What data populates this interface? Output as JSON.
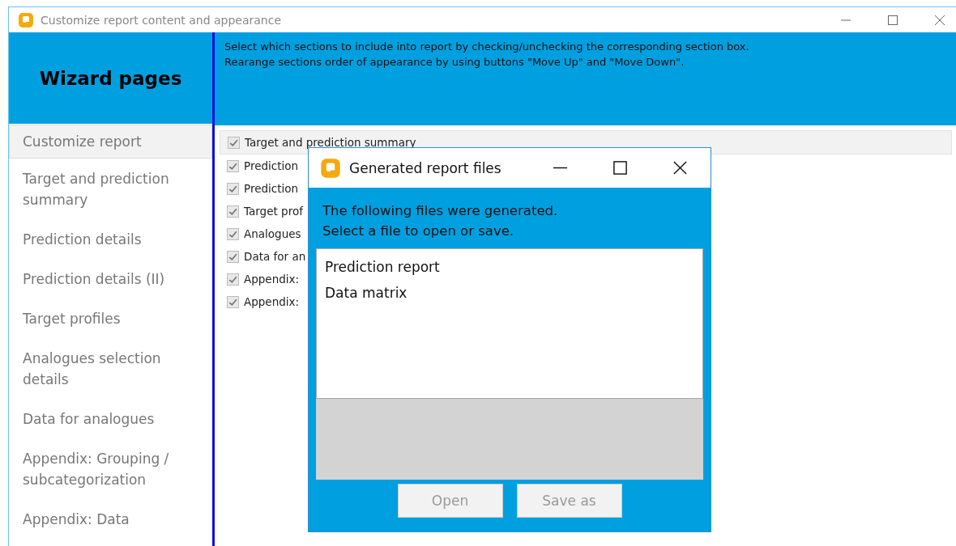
{
  "window": {
    "title": "Customize report content and appearance"
  },
  "sidebar": {
    "title": "Wizard pages",
    "items": [
      {
        "label": "Customize report",
        "selected": true
      },
      {
        "label": "Target and prediction summary",
        "selected": false
      },
      {
        "label": "Prediction details",
        "selected": false
      },
      {
        "label": "Prediction details (II)",
        "selected": false
      },
      {
        "label": "Target profiles",
        "selected": false
      },
      {
        "label": "Analogues selection details",
        "selected": false
      },
      {
        "label": "Data for analogues",
        "selected": false
      },
      {
        "label": "Appendix: Grouping / subcategorization",
        "selected": false
      },
      {
        "label": "Appendix: Data",
        "selected": false
      }
    ]
  },
  "instructions": [
    "Select which sections to include into report by checking/unchecking the corresponding section box.",
    "Rearange sections order of appearance by using buttons \"Move Up\" and \"Move Down\"."
  ],
  "sections": [
    {
      "label": "Target and prediction summary",
      "checked": true,
      "selected": true
    },
    {
      "label": "Prediction",
      "checked": true,
      "selected": false
    },
    {
      "label": "Prediction",
      "checked": true,
      "selected": false
    },
    {
      "label": "Target prof",
      "checked": true,
      "selected": false
    },
    {
      "label": "Analogues",
      "checked": true,
      "selected": false
    },
    {
      "label": "Data for an",
      "checked": true,
      "selected": false
    },
    {
      "label": "Appendix:",
      "checked": true,
      "selected": false
    },
    {
      "label": "Appendix:",
      "checked": true,
      "selected": false
    }
  ],
  "dialog": {
    "title": "Generated report files",
    "message": [
      "The following files were generated.",
      "Select a file to open or save."
    ],
    "files": [
      {
        "label": "Prediction report",
        "selected": false
      },
      {
        "label": "Data matrix",
        "selected": false
      }
    ],
    "buttons": [
      {
        "label": "Open",
        "disabled": true
      },
      {
        "label": "Save as",
        "disabled": true
      }
    ]
  }
}
